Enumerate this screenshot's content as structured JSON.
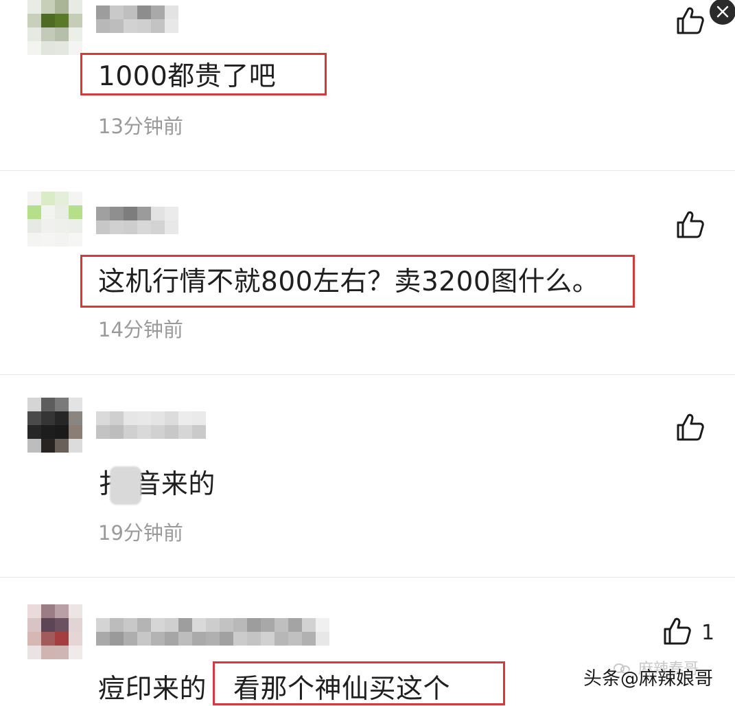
{
  "comments": [
    {
      "content": "1000都贵了吧",
      "time": "13分钟前",
      "like_count": "",
      "highlighted": true,
      "avatar_colors": [
        "#e9ece4",
        "#c7cfb9",
        "#a9b596",
        "#e8ebe3",
        "#c8d0bb",
        "#4d6b22",
        "#5a7a2a",
        "#c5cdb7",
        "#e7eae2",
        "#c3cab8",
        "#b5bfaa",
        "#eceee8",
        "#f3f4f0",
        "#e2e5dd",
        "#e4e7df",
        "#f4f5f2"
      ],
      "name_colors": [
        "#9d9d9d",
        "#b8b8b8",
        "#c9c9c9",
        "#bdbdbd",
        "#bfbfbf",
        "#d2d2d2",
        "#8d8d8d",
        "#cfcfcf",
        "#a9a9a9",
        "#c3c3c3",
        "#e3e3e3",
        "#e8e8e8"
      ]
    },
    {
      "content": "这机行情不就800左右？卖3200图什么。",
      "time": "14分钟前",
      "like_count": "",
      "highlighted": true,
      "avatar_colors": [
        "#f3f4f1",
        "#d9ecc6",
        "#e4eeda",
        "#f4f5f2",
        "#b6df8a",
        "#f2f4ef",
        "#e9ede5",
        "#b6df8a",
        "#e7eae4",
        "#f0f1ee",
        "#eef0ec",
        "#ecefe9",
        "#f4f5f2",
        "#f5f6f3",
        "#f3f4f1",
        "#f6f7f4"
      ],
      "name_colors": [
        "#a0a0a0",
        "#c7c7c7",
        "#8f8f8f",
        "#d0d0d0",
        "#7d7d7d",
        "#cdcdcd",
        "#9b9b9b",
        "#d8d8d8",
        "#e2e2e2",
        "#d3d3d3",
        "#ebebeb",
        "#e8e8e8"
      ]
    },
    {
      "content": "扌 音来的",
      "time": "19分钟前",
      "like_count": "",
      "highlighted": false,
      "avatar_colors": [
        "#d5d5d5",
        "#5d5d5d",
        "#7a7a7a",
        "#e3e3e3",
        "#4a4a4a",
        "#353535",
        "#262626",
        "#8a8580",
        "#262626",
        "#1d1d1d",
        "#1a1a1a",
        "#8b7e74",
        "#bdbdbd",
        "#282422",
        "#6a605a",
        "#dcdcdc"
      ],
      "name_colors": [
        "#dadada",
        "#c3c3c3",
        "#cfcfcf",
        "#bdbdbd",
        "#e6e6e6",
        "#d0d0d0",
        "#e8e8e8",
        "#d9d9d9",
        "#e4e4e4",
        "#d1d1d1",
        "#dcdcdc",
        "#c8c8c8",
        "#ececec",
        "#d6d6d6",
        "#eaeaea",
        "#cacaca"
      ]
    },
    {
      "content": "痘印来的",
      "content_extra": "看那个神仙买这个",
      "time": "",
      "like_count": "1",
      "highlighted": true,
      "avatar_colors": [
        "#eadadb",
        "#9b7d86",
        "#b8a0a6",
        "#ece4e5",
        "#d8c3c5",
        "#5c4656",
        "#6c5260",
        "#e2d3d4",
        "#d7b7b4",
        "#a05b5a",
        "#a53e3f",
        "#e5d5d5",
        "#ebe3e3",
        "#cfb4b2",
        "#cfb6b4",
        "#f0eaea"
      ],
      "name_colors": [
        "#d4d4d4",
        "#a9a9a9",
        "#bcbcbc",
        "#9a9a9a",
        "#c8c8c8",
        "#aeaeae",
        "#b4b4b4",
        "#c7c7c7",
        "#d6d6d6",
        "#b3b3b3",
        "#cfcfcf",
        "#a6a6a6",
        "#9e9e9e",
        "#bdbdbd",
        "#d9d9d9",
        "#aaaaaa",
        "#cdcdcd",
        "#b0b0b0",
        "#c2c2c2",
        "#a1a1a1",
        "#b9b9b9",
        "#cbcbcb",
        "#9d9d9d",
        "#c4c4c4",
        "#a8a8a8",
        "#d1d1d1",
        "#bfbfbf",
        "#b7b7b7",
        "#a4a4a4",
        "#c0c0c0",
        "#d2d2d2",
        "#b1b1b1",
        "#f0f0f0",
        "#e7e7e7"
      ]
    }
  ],
  "watermark": {
    "prefix": "头条",
    "handle": "@麻辣娘哥",
    "ghost": "麻辣春哥"
  },
  "icons": {
    "like": "thumbs-up-icon",
    "close": "close-icon"
  },
  "colors": {
    "highlight_border": "#d9383a",
    "time_text": "#9a9a9a",
    "content_text": "#1f1f1f"
  }
}
